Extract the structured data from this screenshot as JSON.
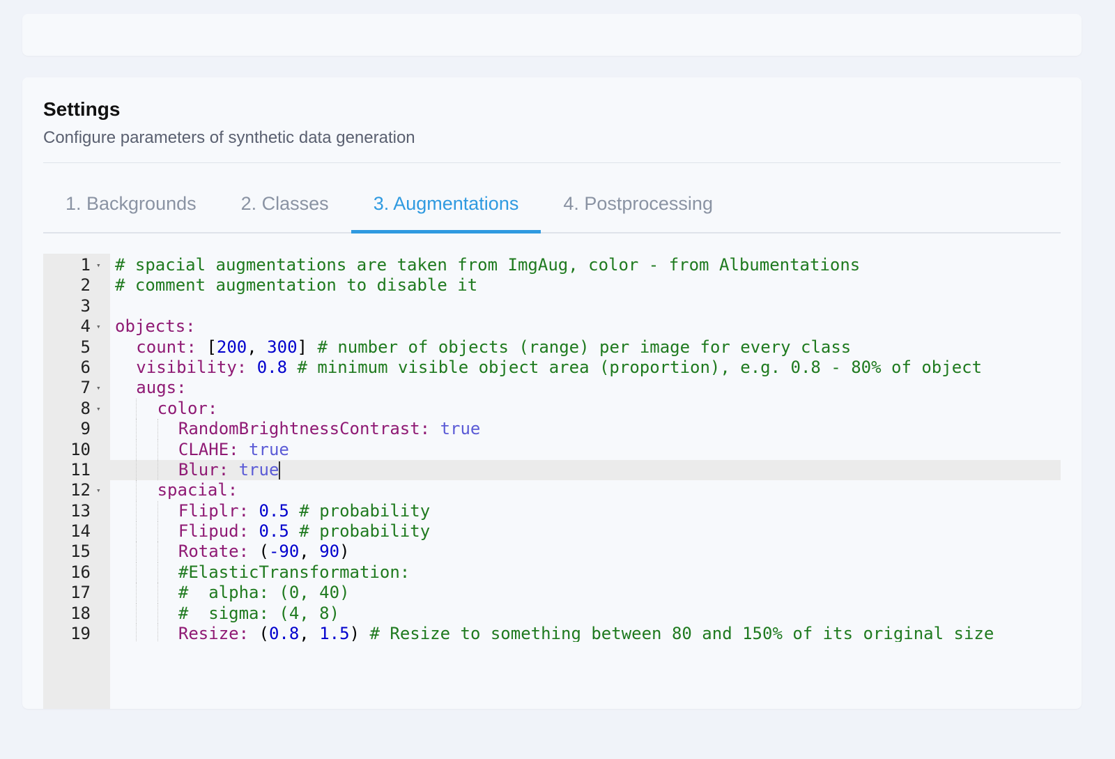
{
  "settings": {
    "title": "Settings",
    "subtitle": "Configure parameters of synthetic data generation"
  },
  "tabs": [
    {
      "label": "1. Backgrounds",
      "active": false
    },
    {
      "label": "2. Classes",
      "active": false
    },
    {
      "label": "3. Augmentations",
      "active": true
    },
    {
      "label": "4. Postprocessing",
      "active": false
    }
  ],
  "colors": {
    "accent": "#2f9ae0",
    "yaml_key": "#8f1a74",
    "yaml_comment": "#1f7a1f",
    "yaml_number": "#0000cd",
    "yaml_boolean": "#5b5bd6"
  },
  "editor": {
    "language": "yaml",
    "current_line": 11,
    "lines": [
      {
        "num": "1",
        "fold": true,
        "indent": 0,
        "parts": [
          {
            "t": "c",
            "text": "# spacial augmentations are taken from ImgAug, color - from Albumentations"
          }
        ]
      },
      {
        "num": "2",
        "fold": false,
        "indent": 0,
        "parts": [
          {
            "t": "c",
            "text": "# comment augmentation to disable it"
          }
        ]
      },
      {
        "num": "3",
        "fold": false,
        "indent": 0,
        "parts": []
      },
      {
        "num": "4",
        "fold": true,
        "indent": 0,
        "parts": [
          {
            "t": "k",
            "text": "objects:"
          }
        ]
      },
      {
        "num": "5",
        "fold": false,
        "indent": 1,
        "parts": [
          {
            "t": "k",
            "text": "count: "
          },
          {
            "t": "p",
            "text": "["
          },
          {
            "t": "n",
            "text": "200"
          },
          {
            "t": "p",
            "text": ", "
          },
          {
            "t": "n",
            "text": "300"
          },
          {
            "t": "p",
            "text": "] "
          },
          {
            "t": "c",
            "text": "# number of objects (range) per image for every class"
          }
        ]
      },
      {
        "num": "6",
        "fold": false,
        "indent": 1,
        "parts": [
          {
            "t": "k",
            "text": "visibility: "
          },
          {
            "t": "n",
            "text": "0.8"
          },
          {
            "t": "p",
            "text": " "
          },
          {
            "t": "c",
            "text": "# minimum visible object area (proportion), e.g. 0.8 - 80% of object"
          }
        ]
      },
      {
        "num": "7",
        "fold": true,
        "indent": 1,
        "parts": [
          {
            "t": "k",
            "text": "augs:"
          }
        ]
      },
      {
        "num": "8",
        "fold": true,
        "indent": 2,
        "parts": [
          {
            "t": "k",
            "text": "color:"
          }
        ]
      },
      {
        "num": "9",
        "fold": false,
        "indent": 3,
        "parts": [
          {
            "t": "k",
            "text": "RandomBrightnessContrast: "
          },
          {
            "t": "b",
            "text": "true"
          }
        ]
      },
      {
        "num": "10",
        "fold": false,
        "indent": 3,
        "parts": [
          {
            "t": "k",
            "text": "CLAHE: "
          },
          {
            "t": "b",
            "text": "true"
          }
        ]
      },
      {
        "num": "11",
        "fold": false,
        "indent": 3,
        "parts": [
          {
            "t": "k",
            "text": "Blur: "
          },
          {
            "t": "b",
            "text": "true"
          }
        ]
      },
      {
        "num": "12",
        "fold": true,
        "indent": 2,
        "parts": [
          {
            "t": "k",
            "text": "spacial:"
          }
        ]
      },
      {
        "num": "13",
        "fold": false,
        "indent": 3,
        "parts": [
          {
            "t": "k",
            "text": "Fliplr: "
          },
          {
            "t": "n",
            "text": "0.5"
          },
          {
            "t": "p",
            "text": " "
          },
          {
            "t": "c",
            "text": "# probability"
          }
        ]
      },
      {
        "num": "14",
        "fold": false,
        "indent": 3,
        "parts": [
          {
            "t": "k",
            "text": "Flipud: "
          },
          {
            "t": "n",
            "text": "0.5"
          },
          {
            "t": "p",
            "text": " "
          },
          {
            "t": "c",
            "text": "# probability"
          }
        ]
      },
      {
        "num": "15",
        "fold": false,
        "indent": 3,
        "parts": [
          {
            "t": "k",
            "text": "Rotate: "
          },
          {
            "t": "p",
            "text": "("
          },
          {
            "t": "n",
            "text": "-90"
          },
          {
            "t": "p",
            "text": ", "
          },
          {
            "t": "n",
            "text": "90"
          },
          {
            "t": "p",
            "text": ")"
          }
        ]
      },
      {
        "num": "16",
        "fold": false,
        "indent": 3,
        "parts": [
          {
            "t": "c",
            "text": "#ElasticTransformation:"
          }
        ]
      },
      {
        "num": "17",
        "fold": false,
        "indent": 3,
        "parts": [
          {
            "t": "c",
            "text": "#  alpha: (0, 40)"
          }
        ]
      },
      {
        "num": "18",
        "fold": false,
        "indent": 3,
        "parts": [
          {
            "t": "c",
            "text": "#  sigma: (4, 8)"
          }
        ]
      },
      {
        "num": "19",
        "fold": false,
        "indent": 3,
        "parts": [
          {
            "t": "k",
            "text": "Resize: "
          },
          {
            "t": "p",
            "text": "("
          },
          {
            "t": "n",
            "text": "0.8"
          },
          {
            "t": "p",
            "text": ", "
          },
          {
            "t": "n",
            "text": "1.5"
          },
          {
            "t": "p",
            "text": ") "
          },
          {
            "t": "c",
            "text": "# Resize to something between 80 and 150% of its original size"
          }
        ]
      }
    ]
  }
}
